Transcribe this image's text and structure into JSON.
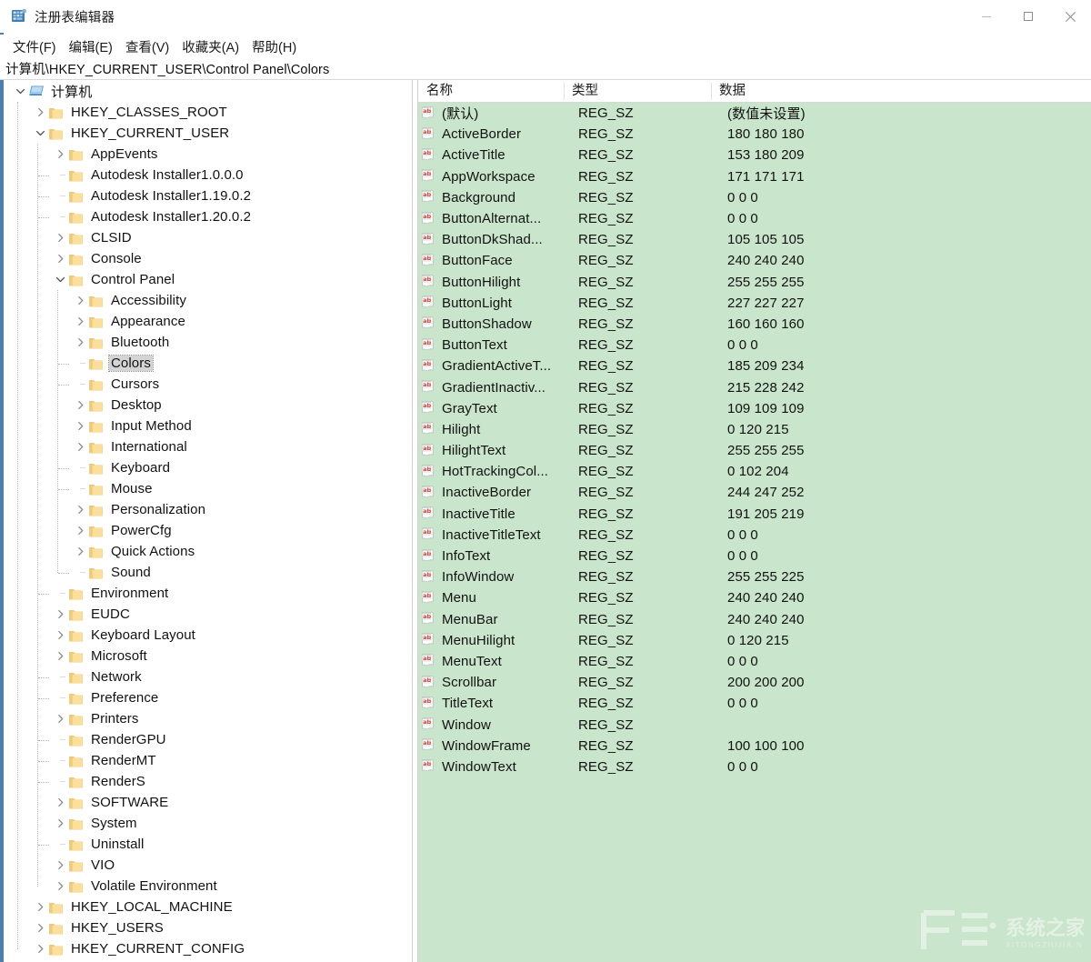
{
  "window": {
    "title": "注册表编辑器",
    "app_icon": "registry-editor-icon",
    "controls": {
      "minimize": "最小化",
      "maximize": "最大化",
      "close": "关闭"
    }
  },
  "menubar": {
    "items": [
      {
        "label": "文件(F)",
        "name": "menu-file"
      },
      {
        "label": "编辑(E)",
        "name": "menu-edit"
      },
      {
        "label": "查看(V)",
        "name": "menu-view"
      },
      {
        "label": "收藏夹(A)",
        "name": "menu-favorites"
      },
      {
        "label": "帮助(H)",
        "name": "menu-help"
      }
    ]
  },
  "address": {
    "path": "计算机\\HKEY_CURRENT_USER\\Control Panel\\Colors"
  },
  "tree": {
    "nodes": [
      {
        "label": "计算机",
        "depth": 0,
        "expander": "down",
        "icon": "computer",
        "selected": false
      },
      {
        "label": "HKEY_CLASSES_ROOT",
        "depth": 1,
        "expander": "right",
        "icon": "folder",
        "selected": false
      },
      {
        "label": "HKEY_CURRENT_USER",
        "depth": 1,
        "expander": "down",
        "icon": "folder",
        "selected": false
      },
      {
        "label": "AppEvents",
        "depth": 2,
        "expander": "right",
        "icon": "folder",
        "selected": false
      },
      {
        "label": "Autodesk Installer1.0.0.0",
        "depth": 2,
        "expander": "none",
        "icon": "folder",
        "selected": false
      },
      {
        "label": "Autodesk Installer1.19.0.2",
        "depth": 2,
        "expander": "none",
        "icon": "folder",
        "selected": false
      },
      {
        "label": "Autodesk Installer1.20.0.2",
        "depth": 2,
        "expander": "none",
        "icon": "folder",
        "selected": false
      },
      {
        "label": "CLSID",
        "depth": 2,
        "expander": "right",
        "icon": "folder",
        "selected": false
      },
      {
        "label": "Console",
        "depth": 2,
        "expander": "right",
        "icon": "folder",
        "selected": false
      },
      {
        "label": "Control Panel",
        "depth": 2,
        "expander": "down",
        "icon": "folder",
        "selected": false
      },
      {
        "label": "Accessibility",
        "depth": 3,
        "expander": "right",
        "icon": "folder",
        "selected": false
      },
      {
        "label": "Appearance",
        "depth": 3,
        "expander": "right",
        "icon": "folder",
        "selected": false
      },
      {
        "label": "Bluetooth",
        "depth": 3,
        "expander": "right",
        "icon": "folder",
        "selected": false
      },
      {
        "label": "Colors",
        "depth": 3,
        "expander": "none",
        "icon": "folder",
        "selected": true
      },
      {
        "label": "Cursors",
        "depth": 3,
        "expander": "none",
        "icon": "folder",
        "selected": false
      },
      {
        "label": "Desktop",
        "depth": 3,
        "expander": "right",
        "icon": "folder",
        "selected": false
      },
      {
        "label": "Input Method",
        "depth": 3,
        "expander": "right",
        "icon": "folder",
        "selected": false
      },
      {
        "label": "International",
        "depth": 3,
        "expander": "right",
        "icon": "folder",
        "selected": false
      },
      {
        "label": "Keyboard",
        "depth": 3,
        "expander": "none",
        "icon": "folder",
        "selected": false
      },
      {
        "label": "Mouse",
        "depth": 3,
        "expander": "none",
        "icon": "folder",
        "selected": false
      },
      {
        "label": "Personalization",
        "depth": 3,
        "expander": "right",
        "icon": "folder",
        "selected": false
      },
      {
        "label": "PowerCfg",
        "depth": 3,
        "expander": "right",
        "icon": "folder",
        "selected": false
      },
      {
        "label": "Quick Actions",
        "depth": 3,
        "expander": "right",
        "icon": "folder",
        "selected": false
      },
      {
        "label": "Sound",
        "depth": 3,
        "expander": "none",
        "icon": "folder",
        "selected": false
      },
      {
        "label": "Environment",
        "depth": 2,
        "expander": "none",
        "icon": "folder",
        "selected": false
      },
      {
        "label": "EUDC",
        "depth": 2,
        "expander": "right",
        "icon": "folder",
        "selected": false
      },
      {
        "label": "Keyboard Layout",
        "depth": 2,
        "expander": "right",
        "icon": "folder",
        "selected": false
      },
      {
        "label": "Microsoft",
        "depth": 2,
        "expander": "right",
        "icon": "folder",
        "selected": false
      },
      {
        "label": "Network",
        "depth": 2,
        "expander": "none",
        "icon": "folder",
        "selected": false
      },
      {
        "label": "Preference",
        "depth": 2,
        "expander": "none",
        "icon": "folder",
        "selected": false
      },
      {
        "label": "Printers",
        "depth": 2,
        "expander": "right",
        "icon": "folder",
        "selected": false
      },
      {
        "label": "RenderGPU",
        "depth": 2,
        "expander": "none",
        "icon": "folder",
        "selected": false
      },
      {
        "label": "RenderMT",
        "depth": 2,
        "expander": "none",
        "icon": "folder",
        "selected": false
      },
      {
        "label": "RenderS",
        "depth": 2,
        "expander": "none",
        "icon": "folder",
        "selected": false
      },
      {
        "label": "SOFTWARE",
        "depth": 2,
        "expander": "right",
        "icon": "folder",
        "selected": false
      },
      {
        "label": "System",
        "depth": 2,
        "expander": "right",
        "icon": "folder",
        "selected": false
      },
      {
        "label": "Uninstall",
        "depth": 2,
        "expander": "none",
        "icon": "folder",
        "selected": false
      },
      {
        "label": "VIO",
        "depth": 2,
        "expander": "right",
        "icon": "folder",
        "selected": false
      },
      {
        "label": "Volatile Environment",
        "depth": 2,
        "expander": "right",
        "icon": "folder",
        "selected": false
      },
      {
        "label": "HKEY_LOCAL_MACHINE",
        "depth": 1,
        "expander": "right",
        "icon": "folder",
        "selected": false
      },
      {
        "label": "HKEY_USERS",
        "depth": 1,
        "expander": "right",
        "icon": "folder",
        "selected": false
      },
      {
        "label": "HKEY_CURRENT_CONFIG",
        "depth": 1,
        "expander": "right",
        "icon": "folder",
        "selected": false
      }
    ]
  },
  "valuelist": {
    "columns": [
      "名称",
      "类型",
      "数据"
    ],
    "row_icon": "string-value-icon",
    "rows": [
      {
        "name": "(默认)",
        "type": "REG_SZ",
        "data": "(数值未设置)"
      },
      {
        "name": "ActiveBorder",
        "type": "REG_SZ",
        "data": "180 180 180"
      },
      {
        "name": "ActiveTitle",
        "type": "REG_SZ",
        "data": "153 180 209"
      },
      {
        "name": "AppWorkspace",
        "type": "REG_SZ",
        "data": "171 171 171"
      },
      {
        "name": "Background",
        "type": "REG_SZ",
        "data": "0 0 0"
      },
      {
        "name": "ButtonAlternat...",
        "type": "REG_SZ",
        "data": "0 0 0"
      },
      {
        "name": "ButtonDkShad...",
        "type": "REG_SZ",
        "data": "105 105 105"
      },
      {
        "name": "ButtonFace",
        "type": "REG_SZ",
        "data": "240 240 240"
      },
      {
        "name": "ButtonHilight",
        "type": "REG_SZ",
        "data": "255 255 255"
      },
      {
        "name": "ButtonLight",
        "type": "REG_SZ",
        "data": "227 227 227"
      },
      {
        "name": "ButtonShadow",
        "type": "REG_SZ",
        "data": "160 160 160"
      },
      {
        "name": "ButtonText",
        "type": "REG_SZ",
        "data": "0 0 0"
      },
      {
        "name": "GradientActiveT...",
        "type": "REG_SZ",
        "data": "185 209 234"
      },
      {
        "name": "GradientInactiv...",
        "type": "REG_SZ",
        "data": "215 228 242"
      },
      {
        "name": "GrayText",
        "type": "REG_SZ",
        "data": "109 109 109"
      },
      {
        "name": "Hilight",
        "type": "REG_SZ",
        "data": "0 120 215"
      },
      {
        "name": "HilightText",
        "type": "REG_SZ",
        "data": "255 255 255"
      },
      {
        "name": "HotTrackingCol...",
        "type": "REG_SZ",
        "data": "0 102 204"
      },
      {
        "name": "InactiveBorder",
        "type": "REG_SZ",
        "data": "244 247 252"
      },
      {
        "name": "InactiveTitle",
        "type": "REG_SZ",
        "data": "191 205 219"
      },
      {
        "name": "InactiveTitleText",
        "type": "REG_SZ",
        "data": "0 0 0"
      },
      {
        "name": "InfoText",
        "type": "REG_SZ",
        "data": "0 0 0"
      },
      {
        "name": "InfoWindow",
        "type": "REG_SZ",
        "data": "255 255 225"
      },
      {
        "name": "Menu",
        "type": "REG_SZ",
        "data": "240 240 240"
      },
      {
        "name": "MenuBar",
        "type": "REG_SZ",
        "data": "240 240 240"
      },
      {
        "name": "MenuHilight",
        "type": "REG_SZ",
        "data": "0 120 215"
      },
      {
        "name": "MenuText",
        "type": "REG_SZ",
        "data": "0 0 0"
      },
      {
        "name": "Scrollbar",
        "type": "REG_SZ",
        "data": "200 200 200"
      },
      {
        "name": "TitleText",
        "type": "REG_SZ",
        "data": "0 0 0"
      },
      {
        "name": "Window",
        "type": "REG_SZ",
        "data": ""
      },
      {
        "name": "WindowFrame",
        "type": "REG_SZ",
        "data": "100 100 100"
      },
      {
        "name": "WindowText",
        "type": "REG_SZ",
        "data": "0 0 0"
      }
    ]
  },
  "watermark": {
    "text": "系统之家",
    "subtext": "XITONGZHIJIA.NET"
  },
  "colors": {
    "list_background": "#c9e5cb",
    "window_background": "#ffffff",
    "edge_stripe": "#4a7fad",
    "folder": "#f7d57e",
    "text": "#121212",
    "selection": "#d4d4d4"
  }
}
